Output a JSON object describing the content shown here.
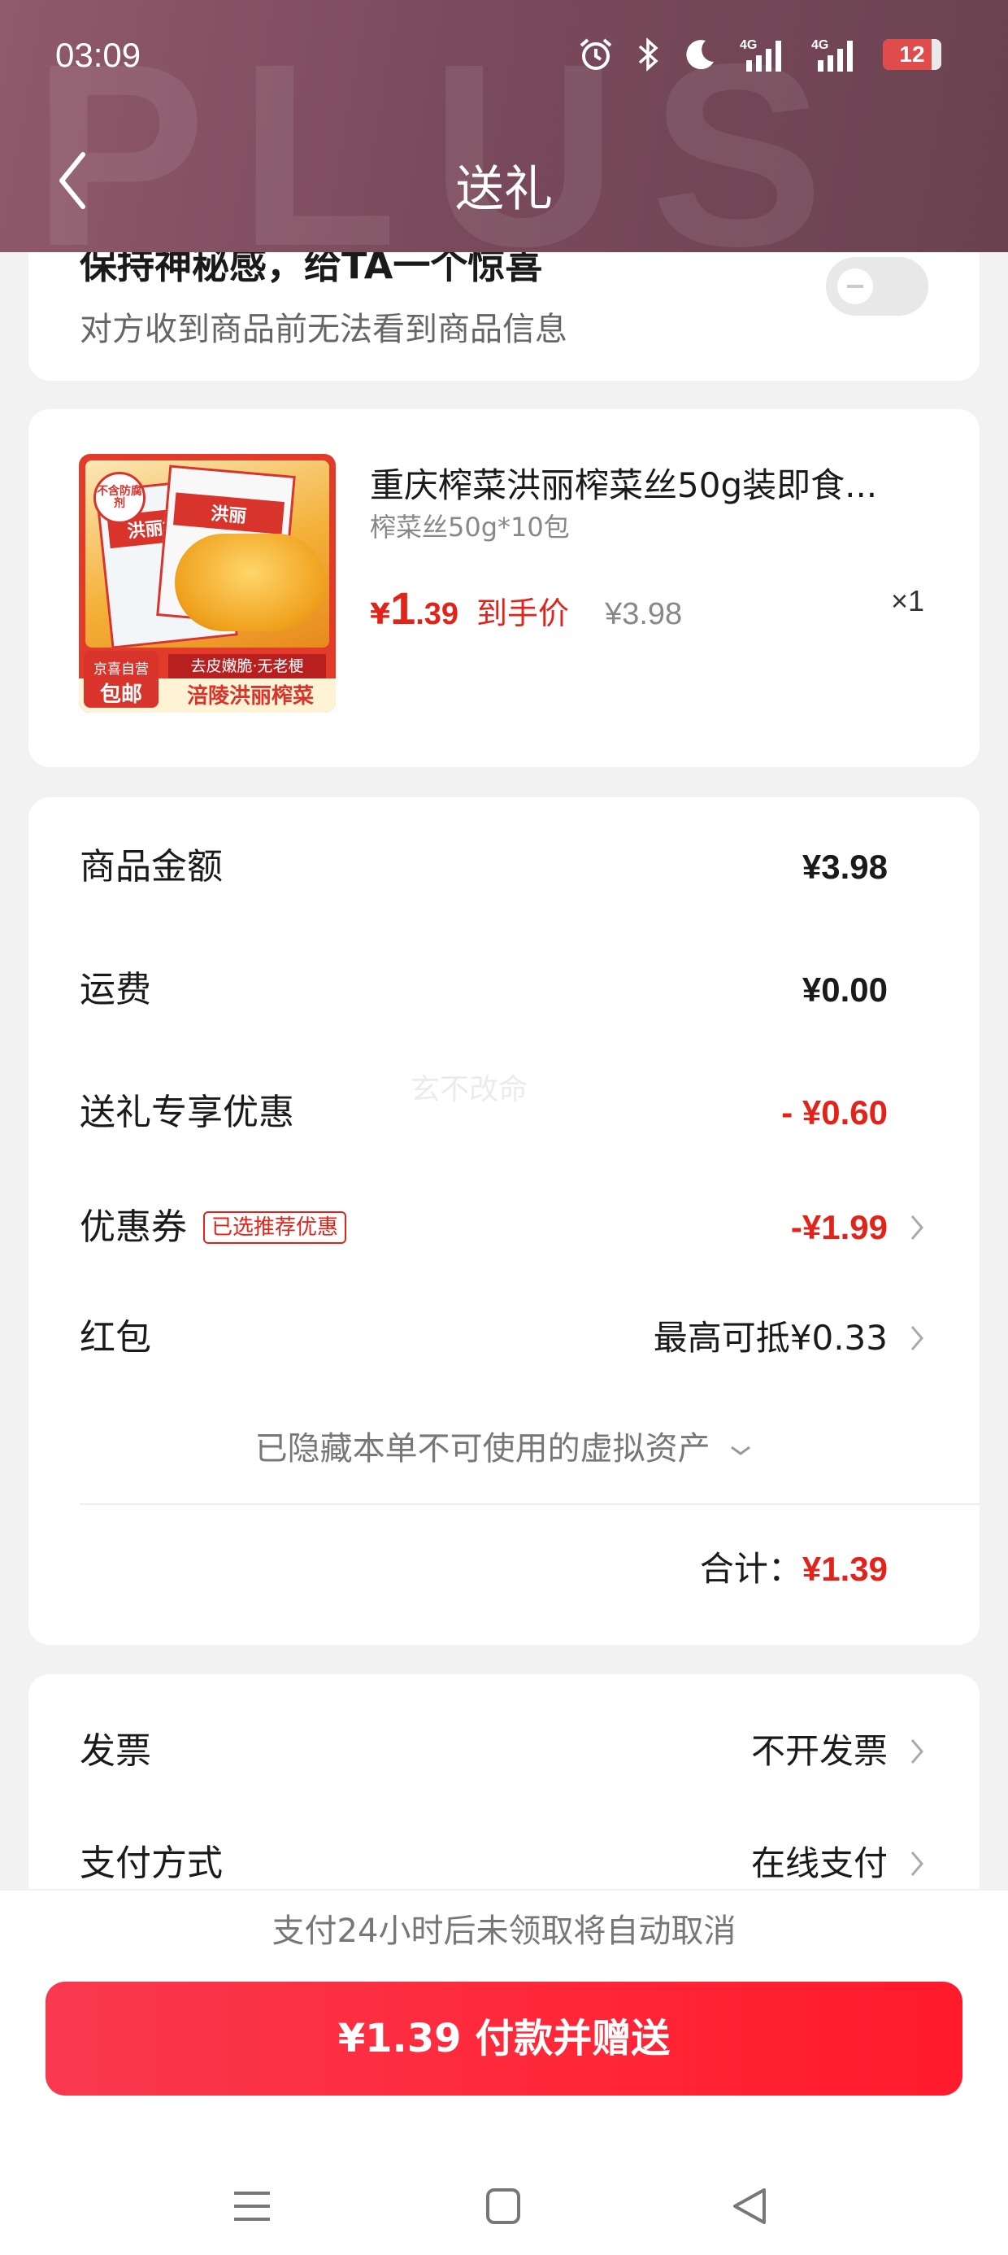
{
  "status_bar": {
    "time": "03:09",
    "icons": [
      "alarm-icon",
      "bluetooth-icon",
      "moon-icon",
      "signal-4g-icon",
      "signal-4g-icon",
      "battery-icon"
    ],
    "battery": "12",
    "network_label_1": "4G",
    "network_label_2": "4G"
  },
  "header": {
    "watermark": "PLUS",
    "title": "送礼",
    "back_icon": "chevron-left-icon"
  },
  "surprise": {
    "title": "保持神秘感，给TA一个惊喜",
    "description": "对方收到商品前无法看到商品信息",
    "toggle_on": false
  },
  "product": {
    "name": "重庆榨菜洪丽榨菜丝50g装即食...",
    "spec": "榨菜丝50g*10包",
    "price_symbol": "¥",
    "price_int": "1",
    "price_dec": ".39",
    "price_label": "到手价",
    "original_price": "¥3.98",
    "quantity": "×1",
    "image": {
      "no_additive": "不含防腐剂",
      "brand_1": "洪丽",
      "pkg_title": "洪丽榨菜",
      "ribbon": "去皮嫩脆·无老梗",
      "footer": "涪陵洪丽榨菜",
      "badge_line1": "京喜自营",
      "badge_line2": "包邮"
    }
  },
  "fees": {
    "goods_amount_label": "商品金额",
    "goods_amount": "¥3.98",
    "shipping_label": "运费",
    "shipping": "¥0.00",
    "gift_discount_label": "送礼专享优惠",
    "gift_discount": "- ¥0.60",
    "coupon_label": "优惠券",
    "coupon_tag": "已选推荐优惠",
    "coupon": "-¥1.99",
    "red_packet_label": "红包",
    "red_packet": "最高可抵¥0.33",
    "hidden_assets": "已隐藏本单不可使用的虚拟资产",
    "watermark": "玄不改命",
    "total_label": "合计：",
    "total": "¥1.39"
  },
  "invoice": {
    "invoice_label": "发票",
    "invoice_value": "不开发票",
    "payment_label": "支付方式",
    "payment_value": "在线支付"
  },
  "notice": "支付24小时后未领取将自动取消",
  "pay_button": "¥1.39 付款并赠送",
  "navbar": [
    "menu-icon",
    "home-square-icon",
    "back-triangle-icon"
  ],
  "colors": {
    "accent_red": "#e2231a",
    "header_bg": "#7a4a5c",
    "pay_button": "#ff2637"
  }
}
